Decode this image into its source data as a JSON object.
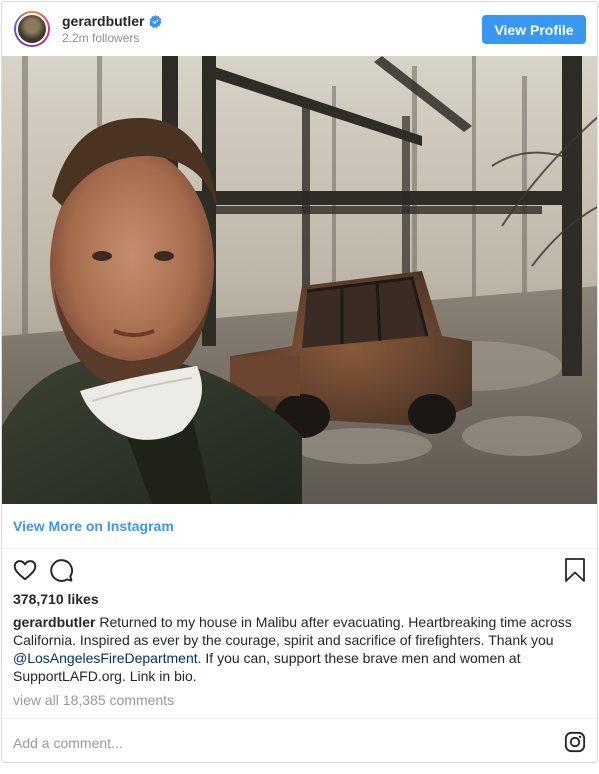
{
  "header": {
    "username": "gerardbutler",
    "verified": true,
    "followers": "2.2m followers",
    "view_profile_label": "View Profile"
  },
  "photo": {
    "subject": "man-selfie-burned-house-ruins"
  },
  "view_more_label": "View More on Instagram",
  "likes": "378,710 likes",
  "caption": {
    "username": "gerardbutler",
    "text_before": " Returned to my house in Malibu after evacuating. Heartbreaking time across California. Inspired as ever by the courage, spirit and sacrifice of firefighters. Thank you ",
    "mention": "@LosAngelesFireDepartment",
    "text_after": ". If you can, support these brave men and women at SupportLAFD.org. Link in bio."
  },
  "view_comments": "view all 18,385 comments",
  "comment_placeholder": "Add a comment...",
  "colors": {
    "accent": "#3897f0",
    "mention": "#003569",
    "muted": "#999999"
  },
  "icons": [
    "verified-icon",
    "heart-icon",
    "comment-icon",
    "bookmark-icon",
    "instagram-icon"
  ]
}
